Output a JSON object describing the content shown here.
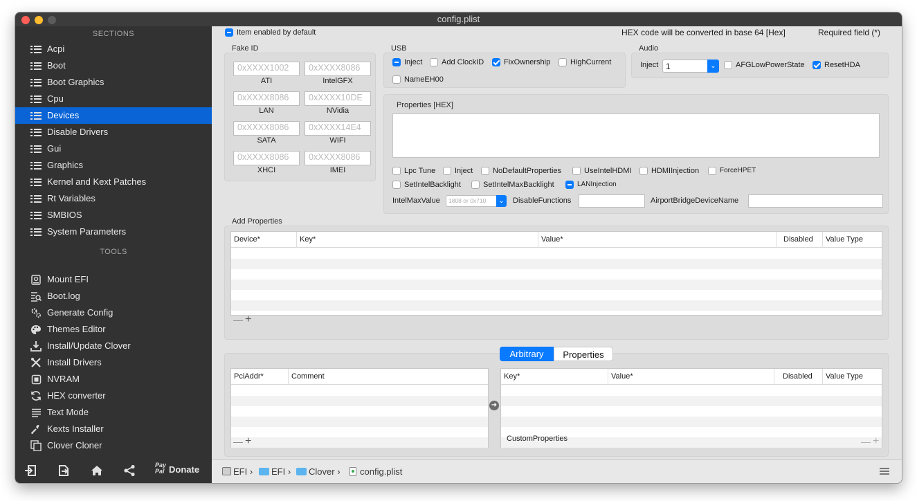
{
  "window": {
    "title": "config.plist"
  },
  "sidebar": {
    "sections_header": "SECTIONS",
    "sections": [
      {
        "label": "Acpi",
        "icon": "list-icon",
        "selected": false
      },
      {
        "label": "Boot",
        "icon": "list-icon",
        "selected": false
      },
      {
        "label": "Boot Graphics",
        "icon": "list-icon",
        "selected": false
      },
      {
        "label": "Cpu",
        "icon": "list-icon",
        "selected": false
      },
      {
        "label": "Devices",
        "icon": "list-icon",
        "selected": true
      },
      {
        "label": "Disable Drivers",
        "icon": "list-icon",
        "selected": false
      },
      {
        "label": "Gui",
        "icon": "list-icon",
        "selected": false
      },
      {
        "label": "Graphics",
        "icon": "list-icon",
        "selected": false
      },
      {
        "label": "Kernel and Kext Patches",
        "icon": "list-icon",
        "selected": false
      },
      {
        "label": "Rt Variables",
        "icon": "list-icon",
        "selected": false
      },
      {
        "label": "SMBIOS",
        "icon": "list-icon",
        "selected": false
      },
      {
        "label": "System Parameters",
        "icon": "list-icon",
        "selected": false
      }
    ],
    "tools_header": "TOOLS",
    "tools": [
      {
        "label": "Mount EFI",
        "icon": "disk-icon"
      },
      {
        "label": "Boot.log",
        "icon": "log-search-icon"
      },
      {
        "label": "Generate Config",
        "icon": "gears-icon"
      },
      {
        "label": "Themes Editor",
        "icon": "palette-icon"
      },
      {
        "label": "Install/Update Clover",
        "icon": "download-icon"
      },
      {
        "label": "Install Drivers",
        "icon": "tools-icon"
      },
      {
        "label": "NVRAM",
        "icon": "chip-icon"
      },
      {
        "label": "HEX converter",
        "icon": "refresh-icon"
      },
      {
        "label": "Text Mode",
        "icon": "text-lines-icon"
      },
      {
        "label": "Kexts Installer",
        "icon": "pipette-icon"
      },
      {
        "label": "Clover Cloner",
        "icon": "copy-icon"
      }
    ],
    "bottom": {
      "donate_label": "Donate",
      "paypal_label": "Pay Pal"
    }
  },
  "header": {
    "item_enabled_label": "Item enabled by default",
    "hex_note": "HEX code will be converted in base 64 [Hex]",
    "required_note": "Required field (*)"
  },
  "fake_id": {
    "title": "Fake ID",
    "fields": [
      {
        "placeholder": "0xXXXX1002",
        "caption": "ATI"
      },
      {
        "placeholder": "0xXXXX8086",
        "caption": "IntelGFX"
      },
      {
        "placeholder": "0xXXXX8086",
        "caption": "LAN"
      },
      {
        "placeholder": "0xXXXX10DE",
        "caption": "NVidia"
      },
      {
        "placeholder": "0xXXXX8086",
        "caption": "SATA"
      },
      {
        "placeholder": "0xXXXX14E4",
        "caption": "WIFI"
      },
      {
        "placeholder": "0xXXXX8086",
        "caption": "XHCI"
      },
      {
        "placeholder": "0xXXXX8086",
        "caption": "IMEI"
      }
    ]
  },
  "usb": {
    "title": "USB",
    "inject": "Inject",
    "add_clockid": "Add ClockID",
    "fixownership": "FixOwnership",
    "highcurrent": "HighCurrent",
    "nameeh00": "NameEH00"
  },
  "audio": {
    "title": "Audio",
    "inject_label": "Inject",
    "inject_value": "1",
    "afglow": "AFGLowPowerState",
    "resethda": "ResetHDA"
  },
  "properties": {
    "title": "Properties [HEX]",
    "lpc_tune": "Lpc Tune",
    "inject": "Inject",
    "nodefault": "NoDefaultProperties",
    "useintelhdmi": "UseIntelHDMI",
    "hdmiinjection": "HDMIInjection",
    "forcehpet": "ForceHPET",
    "setintelbacklight": "SetIntelBacklight",
    "setintelmaxbacklight": "SetIntelMaxBacklight",
    "laninjection": "LANInjection",
    "intelmaxvalue_label": "IntelMaxValue",
    "intelmaxvalue_placeholder": "1808 or 0x710",
    "disablefunctions_label": "DisableFunctions",
    "airport_label": "AirportBridgeDeviceName"
  },
  "add_properties": {
    "title": "Add Properties",
    "columns": [
      "Device*",
      "Key*",
      "Value*",
      "Disabled",
      "Value Type"
    ]
  },
  "segmented": {
    "arbitrary": "Arbitrary",
    "properties": "Properties"
  },
  "arbitrary": {
    "left_columns": [
      "PciAddr*",
      "Comment"
    ],
    "right_columns": [
      "Key*",
      "Value*",
      "Disabled",
      "Value Type"
    ],
    "custom_label": "CustomProperties"
  },
  "pathbar": {
    "items": [
      "EFI",
      "EFI",
      "Clover",
      "config.plist"
    ]
  }
}
